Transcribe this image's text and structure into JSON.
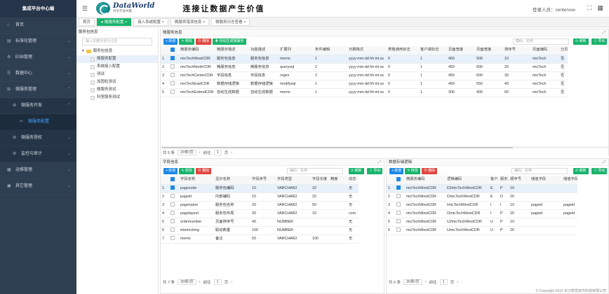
{
  "app_title": "集成平台中心端",
  "nav": {
    "items": [
      {
        "icon": "home-icon",
        "label": "首页"
      },
      {
        "icon": "standard-icon",
        "label": "标准化管理"
      },
      {
        "icon": "esb-icon",
        "label": "ESB管理"
      },
      {
        "icon": "data-icon",
        "label": "数据中心"
      },
      {
        "icon": "microservice-icon",
        "label": "微服务管理"
      }
    ],
    "sub": {
      "dev": "微服务开发",
      "config": "微服务配置",
      "auth": "微服务授权",
      "monitor": "监控与审计"
    },
    "bottom": [
      {
        "icon": "ops-icon",
        "label": "运维管理"
      },
      {
        "icon": "other-icon",
        "label": "其它管理"
      }
    ]
  },
  "header": {
    "logo_text": "DataWorld",
    "logo_sub": "共享开放共赢",
    "slogan": "连接让数据产生价值",
    "login": "登录人员：centervue"
  },
  "tabs": [
    {
      "label": "首页"
    },
    {
      "label": "微服务配置",
      "active": true
    },
    {
      "label": "接入系统配置"
    },
    {
      "label": "微服务错误信息"
    },
    {
      "label": "微服务日志查看"
    }
  ],
  "tree": {
    "title": "服务包信息",
    "filter_placeholder": "输入关键字进行过滤",
    "root": "服务包信息",
    "children": [
      "微服务配置",
      "系统接入配置",
      "测试",
      "加固检测试",
      "微服务测试",
      "科室服务测试"
    ]
  },
  "top": {
    "title": "微服务信息",
    "buttons": {
      "add": "+ 新增",
      "edit": "✎ 修改",
      "del": "⊖ 删除",
      "auto": "✚ 自动生成微服务"
    },
    "search_placeholder": "模码、名称",
    "refresh": "⟳ 刷新",
    "export": "⇩ 导出",
    "columns": [
      "",
      "",
      "微服务编码",
      "微服务描述",
      "功能描述",
      "扩展列",
      "条件编辑",
      "日期格式",
      "表格通用标志",
      "客户端标志",
      "页面宽度",
      "页面宽度",
      "排序号",
      "页面编码",
      "分页"
    ],
    "rows": [
      [
        "1",
        "on",
        "micTechWestCDR",
        "服务包信息",
        "服务包信息",
        "memo",
        "1",
        "yyyy-mm-dd hh:mi:ss",
        "0",
        "1",
        "460",
        "500",
        "10",
        "micTech",
        "否"
      ],
      [
        "2",
        "",
        "micTechNorthCDR",
        "微服务信息",
        "微服务信息",
        "querysql",
        "2",
        "yyyy-mm-dd hh:mi:ss",
        "0",
        "1",
        "450",
        "600",
        "20",
        "micTech",
        "否"
      ],
      [
        "3",
        "",
        "micTechCenterCDR",
        "字段信息",
        "字段信息",
        "regex",
        "2",
        "yyyy-mm-dd hh:mi:ss",
        "0",
        "1",
        "450",
        "600",
        "30",
        "micTech",
        "否"
      ],
      [
        "4",
        "",
        "micTechEastCDR",
        "数据存储逻辑",
        "数据存储逻辑",
        "modifysql",
        "1",
        "yyyy-mm-dd hh:mi:ss",
        "0",
        "1",
        "450",
        "550",
        "40",
        "micTech",
        "否"
      ],
      [
        "5",
        "",
        "micTechExtendCDR",
        "自动生成数据",
        "自动生成数据",
        "memo",
        "1",
        "yyyy-mm-dd hh:mi:ss",
        "0",
        "1",
        "300",
        "400",
        "60",
        "micTech",
        "否"
      ]
    ],
    "pager": {
      "total": "共 5 条",
      "size": "20条/页",
      "goto": "前往",
      "page": "1",
      "unit": "页"
    }
  },
  "left": {
    "title": "字段信息",
    "buttons": {
      "add": "+ 新增",
      "edit": "✎ 修改",
      "del": "⊖ 删除"
    },
    "search_placeholder": "编码、名称",
    "refresh": "⟳ 刷新",
    "export": "⇩ 导出",
    "columns": [
      "",
      "",
      "字段名称",
      "显示名称",
      "字段序号",
      "字段类型",
      "字段长度",
      "精度",
      "动态"
    ],
    "rows": [
      [
        "1",
        "on",
        "pagecode",
        "服务包编码",
        "10",
        "VARCHAR2",
        "32",
        "",
        "无"
      ],
      [
        "2",
        "",
        "pageid",
        "内部编码",
        "10",
        "VARCHAR2",
        "32",
        "",
        "无"
      ],
      [
        "3",
        "",
        "pagename",
        "服务包名称",
        "20",
        "VARCHAR2",
        "50",
        "",
        "无"
      ],
      [
        "4",
        "",
        "pagelayout",
        "服务包布局",
        "30",
        "VARCHAR2",
        "10",
        "",
        "com"
      ],
      [
        "5",
        "",
        "ordernumber",
        "页面排序号",
        "40",
        "NUMBER",
        "",
        "",
        "无"
      ],
      [
        "6",
        "",
        "interlocking",
        "联动数量",
        "100",
        "NUMBER",
        "",
        "",
        "无"
      ],
      [
        "7",
        "",
        "memo",
        "备注",
        "50",
        "VARCHAR2",
        "100",
        "",
        "无"
      ]
    ],
    "pager": {
      "total": "共 7 条",
      "size": "20条/页",
      "goto": "前往",
      "page": "1",
      "unit": "页"
    }
  },
  "right": {
    "title": "数据存储逻辑",
    "buttons": {
      "add": "+ 新增",
      "edit": "✎ 修改",
      "del": "⊖ 删除"
    },
    "search_placeholder": "编码、名称",
    "refresh": "⟳ 刷新",
    "export": "⇩ 导出",
    "columns": [
      "",
      "",
      "微服务编码",
      "逻辑编码",
      "客户...",
      "服务...",
      "顺序号",
      "储值字段",
      "储值字段"
    ],
    "rows": [
      [
        "1",
        "on",
        "micTechWestCDR",
        "D2micTechWestCDR",
        "E",
        "P",
        "10",
        "",
        ""
      ],
      [
        "2",
        "",
        "micTechWestCDR",
        "DmicTechWestCDR",
        "E",
        "D",
        "20",
        "",
        ""
      ],
      [
        "3",
        "",
        "micTechWestCDR",
        "ImicTechWestCDR",
        "I",
        "I",
        "10",
        "pageid",
        "pageid"
      ],
      [
        "4",
        "",
        "micTechWestCDR",
        "I2micTechWestCDR",
        "I",
        "P",
        "20",
        "pageid",
        "pageid"
      ],
      [
        "5",
        "",
        "micTechWestCDR",
        "U2micTechWestCDR",
        "U",
        "P",
        "10",
        "",
        ""
      ],
      [
        "6",
        "",
        "micTechWestCDR",
        "UmicTechWestCDR",
        "U",
        "P",
        "20",
        "",
        ""
      ]
    ],
    "pager": {
      "total": "共 6 条",
      "size": "20条/页",
      "goto": "前往",
      "page": "1",
      "unit": "页"
    }
  },
  "footer": "© Copyright 2015 长沙梦爱软件科技有限公司"
}
